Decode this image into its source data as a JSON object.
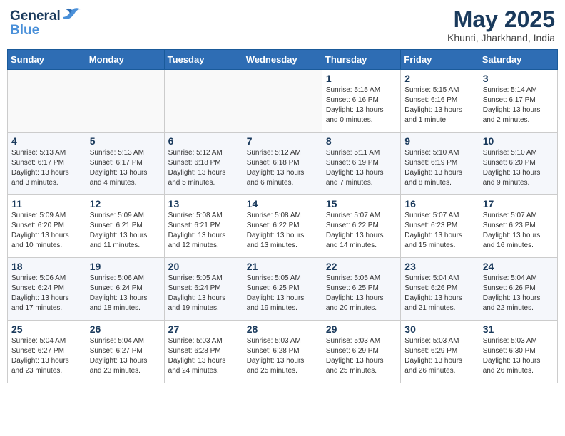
{
  "header": {
    "logo_line1": "General",
    "logo_line2": "Blue",
    "month_title": "May 2025",
    "location": "Khunti, Jharkhand, India"
  },
  "weekdays": [
    "Sunday",
    "Monday",
    "Tuesday",
    "Wednesday",
    "Thursday",
    "Friday",
    "Saturday"
  ],
  "weeks": [
    [
      {
        "day": "",
        "info": ""
      },
      {
        "day": "",
        "info": ""
      },
      {
        "day": "",
        "info": ""
      },
      {
        "day": "",
        "info": ""
      },
      {
        "day": "1",
        "info": "Sunrise: 5:15 AM\nSunset: 6:16 PM\nDaylight: 13 hours\nand 0 minutes."
      },
      {
        "day": "2",
        "info": "Sunrise: 5:15 AM\nSunset: 6:16 PM\nDaylight: 13 hours\nand 1 minute."
      },
      {
        "day": "3",
        "info": "Sunrise: 5:14 AM\nSunset: 6:17 PM\nDaylight: 13 hours\nand 2 minutes."
      }
    ],
    [
      {
        "day": "4",
        "info": "Sunrise: 5:13 AM\nSunset: 6:17 PM\nDaylight: 13 hours\nand 3 minutes."
      },
      {
        "day": "5",
        "info": "Sunrise: 5:13 AM\nSunset: 6:17 PM\nDaylight: 13 hours\nand 4 minutes."
      },
      {
        "day": "6",
        "info": "Sunrise: 5:12 AM\nSunset: 6:18 PM\nDaylight: 13 hours\nand 5 minutes."
      },
      {
        "day": "7",
        "info": "Sunrise: 5:12 AM\nSunset: 6:18 PM\nDaylight: 13 hours\nand 6 minutes."
      },
      {
        "day": "8",
        "info": "Sunrise: 5:11 AM\nSunset: 6:19 PM\nDaylight: 13 hours\nand 7 minutes."
      },
      {
        "day": "9",
        "info": "Sunrise: 5:10 AM\nSunset: 6:19 PM\nDaylight: 13 hours\nand 8 minutes."
      },
      {
        "day": "10",
        "info": "Sunrise: 5:10 AM\nSunset: 6:20 PM\nDaylight: 13 hours\nand 9 minutes."
      }
    ],
    [
      {
        "day": "11",
        "info": "Sunrise: 5:09 AM\nSunset: 6:20 PM\nDaylight: 13 hours\nand 10 minutes."
      },
      {
        "day": "12",
        "info": "Sunrise: 5:09 AM\nSunset: 6:21 PM\nDaylight: 13 hours\nand 11 minutes."
      },
      {
        "day": "13",
        "info": "Sunrise: 5:08 AM\nSunset: 6:21 PM\nDaylight: 13 hours\nand 12 minutes."
      },
      {
        "day": "14",
        "info": "Sunrise: 5:08 AM\nSunset: 6:22 PM\nDaylight: 13 hours\nand 13 minutes."
      },
      {
        "day": "15",
        "info": "Sunrise: 5:07 AM\nSunset: 6:22 PM\nDaylight: 13 hours\nand 14 minutes."
      },
      {
        "day": "16",
        "info": "Sunrise: 5:07 AM\nSunset: 6:23 PM\nDaylight: 13 hours\nand 15 minutes."
      },
      {
        "day": "17",
        "info": "Sunrise: 5:07 AM\nSunset: 6:23 PM\nDaylight: 13 hours\nand 16 minutes."
      }
    ],
    [
      {
        "day": "18",
        "info": "Sunrise: 5:06 AM\nSunset: 6:24 PM\nDaylight: 13 hours\nand 17 minutes."
      },
      {
        "day": "19",
        "info": "Sunrise: 5:06 AM\nSunset: 6:24 PM\nDaylight: 13 hours\nand 18 minutes."
      },
      {
        "day": "20",
        "info": "Sunrise: 5:05 AM\nSunset: 6:24 PM\nDaylight: 13 hours\nand 19 minutes."
      },
      {
        "day": "21",
        "info": "Sunrise: 5:05 AM\nSunset: 6:25 PM\nDaylight: 13 hours\nand 19 minutes."
      },
      {
        "day": "22",
        "info": "Sunrise: 5:05 AM\nSunset: 6:25 PM\nDaylight: 13 hours\nand 20 minutes."
      },
      {
        "day": "23",
        "info": "Sunrise: 5:04 AM\nSunset: 6:26 PM\nDaylight: 13 hours\nand 21 minutes."
      },
      {
        "day": "24",
        "info": "Sunrise: 5:04 AM\nSunset: 6:26 PM\nDaylight: 13 hours\nand 22 minutes."
      }
    ],
    [
      {
        "day": "25",
        "info": "Sunrise: 5:04 AM\nSunset: 6:27 PM\nDaylight: 13 hours\nand 23 minutes."
      },
      {
        "day": "26",
        "info": "Sunrise: 5:04 AM\nSunset: 6:27 PM\nDaylight: 13 hours\nand 23 minutes."
      },
      {
        "day": "27",
        "info": "Sunrise: 5:03 AM\nSunset: 6:28 PM\nDaylight: 13 hours\nand 24 minutes."
      },
      {
        "day": "28",
        "info": "Sunrise: 5:03 AM\nSunset: 6:28 PM\nDaylight: 13 hours\nand 25 minutes."
      },
      {
        "day": "29",
        "info": "Sunrise: 5:03 AM\nSunset: 6:29 PM\nDaylight: 13 hours\nand 25 minutes."
      },
      {
        "day": "30",
        "info": "Sunrise: 5:03 AM\nSunset: 6:29 PM\nDaylight: 13 hours\nand 26 minutes."
      },
      {
        "day": "31",
        "info": "Sunrise: 5:03 AM\nSunset: 6:30 PM\nDaylight: 13 hours\nand 26 minutes."
      }
    ]
  ]
}
